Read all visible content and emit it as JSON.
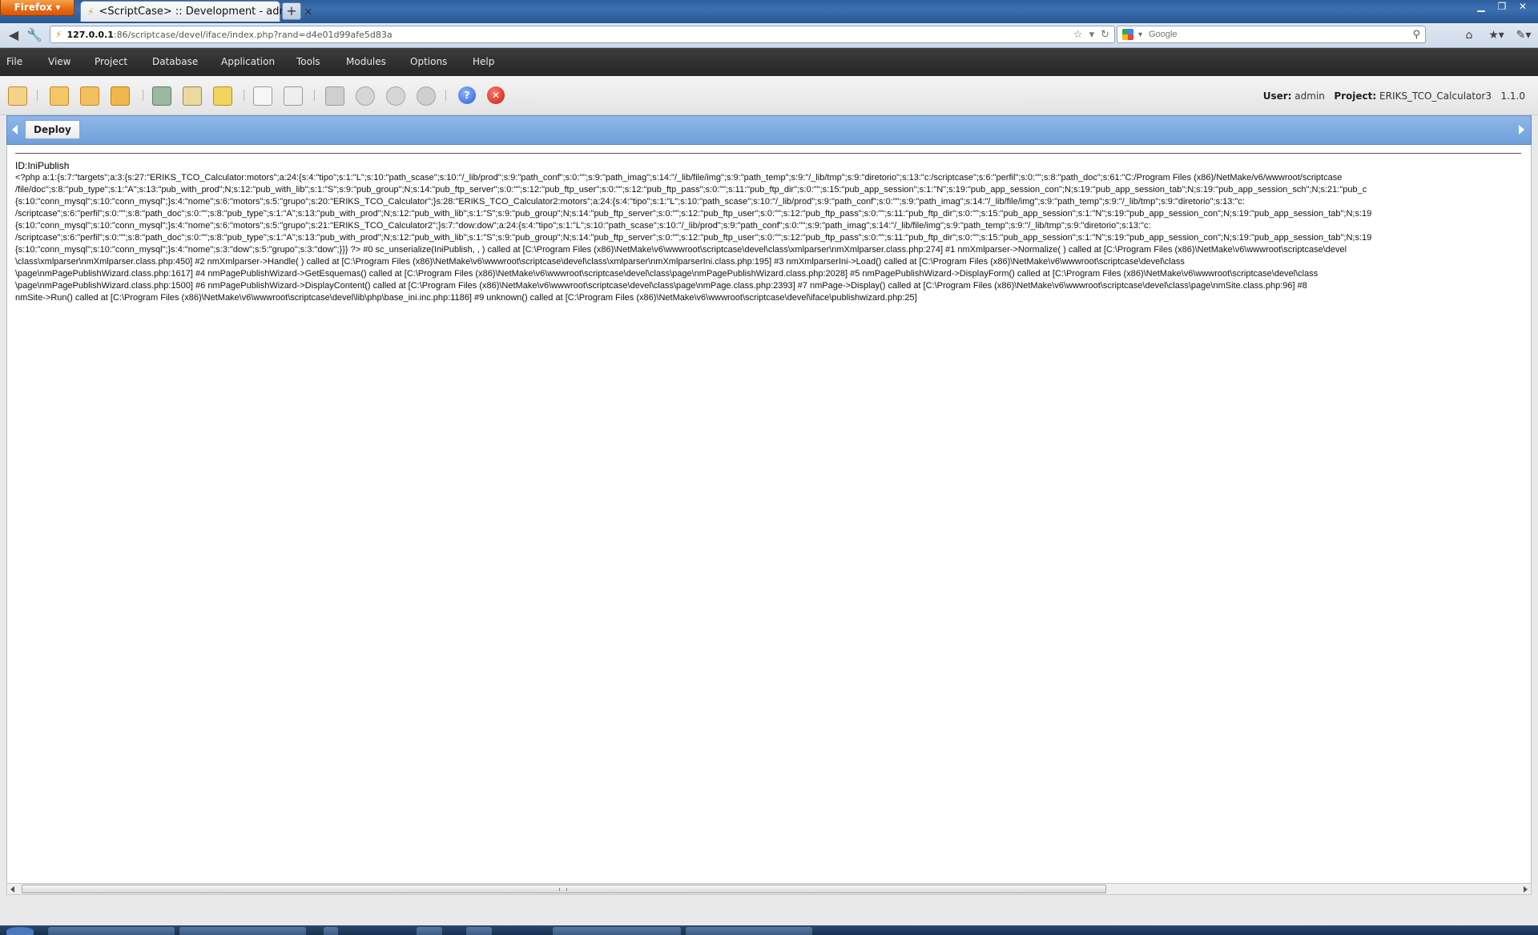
{
  "browser": {
    "menu_button": "Firefox",
    "tab_title": "<ScriptCase> :: Development - admin",
    "new_tab": "+",
    "url_host": "127.0.0.1",
    "url_path": ":86/scriptcase/devel/iface/index.php?rand=d4e01d99afe5d83a",
    "search_placeholder": "Google"
  },
  "menu": {
    "items": [
      "File",
      "View",
      "Project",
      "Database",
      "Application",
      "Tools",
      "Modules",
      "Options",
      "Help"
    ]
  },
  "toolbar": {
    "user_label": "User:",
    "user_value": "admin",
    "project_label": "Project:",
    "project_value": "ERIKS_TCO_Calculator3",
    "version": "1.1.0"
  },
  "deploy": {
    "tab_label": "Deploy"
  },
  "content": {
    "error_id": "ID:IniPublish",
    "dump_lines": [
      "<?php a:1:{s:7:\"targets\";a:3:{s:27:\"ERIKS_TCO_Calculator:motors\";a:24:{s:4:\"tipo\";s:1:\"L\";s:10:\"path_scase\";s:10:\"/_lib/prod\";s:9:\"path_conf\";s:0:\"\";s:9:\"path_imag\";s:14:\"/_lib/file/img\";s:9:\"path_temp\";s:9:\"/_lib/tmp\";s:9:\"diretorio\";s:13:\"c:/scriptcase\";s:6:\"perfil\";s:0:\"\";s:8:\"path_doc\";s:61:\"C:/Program Files (x86)/NetMake/v6/wwwroot/scriptcase",
      "/file/doc\";s:8:\"pub_type\";s:1:\"A\";s:13:\"pub_with_prod\";N;s:12:\"pub_with_lib\";s:1:\"S\";s:9:\"pub_group\";N;s:14:\"pub_ftp_server\";s:0:\"\";s:12:\"pub_ftp_user\";s:0:\"\";s:12:\"pub_ftp_pass\";s:0:\"\";s:11:\"pub_ftp_dir\";s:0:\"\";s:15:\"pub_app_session\";s:1:\"N\";s:19:\"pub_app_session_con\";N;s:19:\"pub_app_session_tab\";N;s:19:\"pub_app_session_sch\";N;s:21:\"pub_c",
      "{s:10:\"conn_mysql\";s:10:\"conn_mysql\";}s:4:\"nome\";s:6:\"motors\";s:5:\"grupo\";s:20:\"ERIKS_TCO_Calculator\";}s:28:\"ERIKS_TCO_Calculator2:motors\";a:24:{s:4:\"tipo\";s:1:\"L\";s:10:\"path_scase\";s:10:\"/_lib/prod\";s:9:\"path_conf\";s:0:\"\";s:9:\"path_imag\";s:14:\"/_lib/file/img\";s:9:\"path_temp\";s:9:\"/_lib/tmp\";s:9:\"diretorio\";s:13:\"c:",
      "/scriptcase\";s:6:\"perfil\";s:0:\"\";s:8:\"path_doc\";s:0:\"\";s:8:\"pub_type\";s:1:\"A\";s:13:\"pub_with_prod\";N;s:12:\"pub_with_lib\";s:1:\"S\";s:9:\"pub_group\";N;s:14:\"pub_ftp_server\";s:0:\"\";s:12:\"pub_ftp_user\";s:0:\"\";s:12:\"pub_ftp_pass\";s:0:\"\";s:11:\"pub_ftp_dir\";s:0:\"\";s:15:\"pub_app_session\";s:1:\"N\";s:19:\"pub_app_session_con\";N;s:19:\"pub_app_session_tab\";N;s:19",
      "{s:10:\"conn_mysql\";s:10:\"conn_mysql\";}s:4:\"nome\";s:6:\"motors\";s:5:\"grupo\";s:21:\"ERIKS_TCO_Calculator2\";}s:7:\"dow:dow\";a:24:{s:4:\"tipo\";s:1:\"L\";s:10:\"path_scase\";s:10:\"/_lib/prod\";s:9:\"path_conf\";s:0:\"\";s:9:\"path_imag\";s:14:\"/_lib/file/img\";s:9:\"path_temp\";s:9:\"/_lib/tmp\";s:9:\"diretorio\";s:13:\"c:",
      "/scriptcase\";s:6:\"perfil\";s:0:\"\";s:8:\"path_doc\";s:0:\"\";s:8:\"pub_type\";s:1:\"A\";s:13:\"pub_with_prod\";N;s:12:\"pub_with_lib\";s:1:\"S\";s:9:\"pub_group\";N;s:14:\"pub_ftp_server\";s:0:\"\";s:12:\"pub_ftp_user\";s:0:\"\";s:12:\"pub_ftp_pass\";s:0:\"\";s:11:\"pub_ftp_dir\";s:0:\"\";s:15:\"pub_app_session\";s:1:\"N\";s:19:\"pub_app_session_con\";N;s:19:\"pub_app_session_tab\";N;s:19",
      "{s:10:\"conn_mysql\";s:10:\"conn_mysql\";}s:4:\"nome\";s:3:\"dow\";s:5:\"grupo\";s:3:\"dow\";}}} ?> #0 sc_unserialize(IniPublish, , ) called at [C:\\Program Files (x86)\\NetMake\\v6\\wwwroot\\scriptcase\\devel\\class\\xmlparser\\nmXmlparser.class.php:274] #1 nmXmlparser->Normalize( ) called at [C:\\Program Files (x86)\\NetMake\\v6\\wwwroot\\scriptcase\\devel",
      "\\class\\xmlparser\\nmXmlparser.class.php:450] #2 nmXmlparser->Handle( ) called at [C:\\Program Files (x86)\\NetMake\\v6\\wwwroot\\scriptcase\\devel\\class\\xmlparser\\nmXmlparserIni.class.php:195] #3 nmXmlparserIni->Load() called at [C:\\Program Files (x86)\\NetMake\\v6\\wwwroot\\scriptcase\\devel\\class",
      "\\page\\nmPagePublishWizard.class.php:1617] #4 nmPagePublishWizard->GetEsquemas() called at [C:\\Program Files (x86)\\NetMake\\v6\\wwwroot\\scriptcase\\devel\\class\\page\\nmPagePublishWizard.class.php:2028] #5 nmPagePublishWizard->DisplayForm() called at [C:\\Program Files (x86)\\NetMake\\v6\\wwwroot\\scriptcase\\devel\\class",
      "\\page\\nmPagePublishWizard.class.php:1500] #6 nmPagePublishWizard->DisplayContent() called at [C:\\Program Files (x86)\\NetMake\\v6\\wwwroot\\scriptcase\\devel\\class\\page\\nmPage.class.php:2393] #7 nmPage->Display() called at [C:\\Program Files (x86)\\NetMake\\v6\\wwwroot\\scriptcase\\devel\\class\\page\\nmSite.class.php:96] #8",
      "nmSite->Run() called at [C:\\Program Files (x86)\\NetMake\\v6\\wwwroot\\scriptcase\\devel\\lib\\php\\base_ini.inc.php:1186] #9 unknown() called at [C:\\Program Files (x86)\\NetMake\\v6\\wwwroot\\scriptcase\\devel\\iface\\publishwizard.php:25]"
    ]
  },
  "colors": {
    "deploy_bar": "#7aa7e0",
    "menubar": "#2f2f2f",
    "firefox_orange": "#e66a10"
  }
}
